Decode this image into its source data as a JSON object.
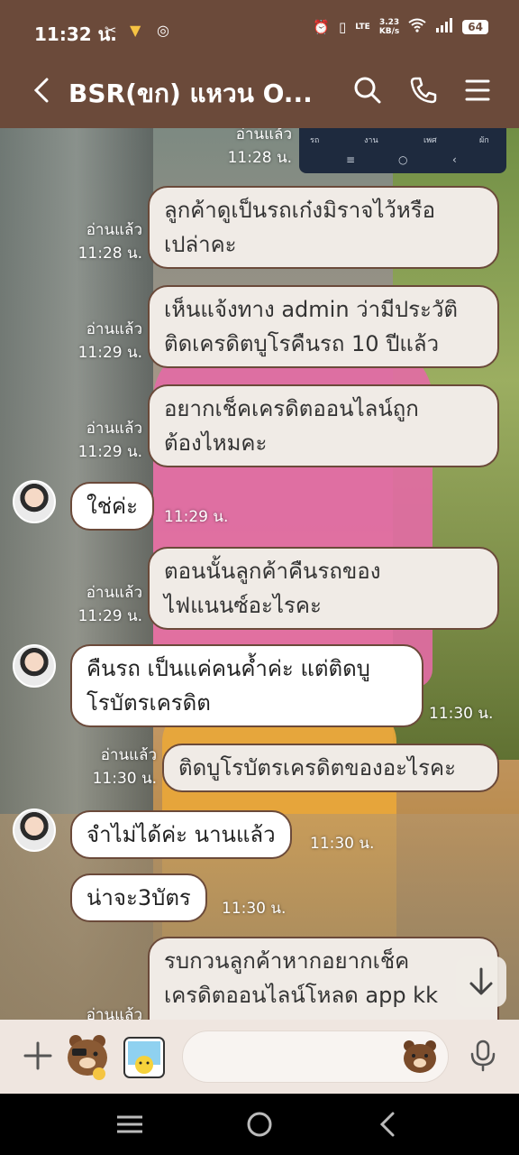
{
  "status_bar": {
    "time": "11:32 น.",
    "network_speed_value": "3.23",
    "network_speed_unit": "KB/s",
    "network_type": "LTE",
    "battery": "64"
  },
  "header": {
    "title": "BSR(ขก) แหวน O...",
    "icons": [
      "back-icon",
      "search-icon",
      "phone-icon",
      "menu-icon"
    ]
  },
  "embedded_screenshot": {
    "tabs": [
      "รถ",
      "งาน",
      "เพศ",
      "ผัก"
    ]
  },
  "messages": [
    {
      "dir": "out",
      "read": "อ่านแล้ว",
      "time": "11:28 น.",
      "lines": []
    },
    {
      "dir": "out",
      "read": "อ่านแล้ว",
      "time": "11:28 น.",
      "lines": [
        "ลูกค้าดูเป็นรถเก๋งมิราจไว้หรือ",
        "เปล่าคะ"
      ]
    },
    {
      "dir": "out",
      "read": "อ่านแล้ว",
      "time": "11:29 น.",
      "lines": [
        "เห็นแจ้งทาง admin ว่ามีประวัติ",
        "ติดเครดิตบูโรคืนรถ 10 ปีแล้ว"
      ]
    },
    {
      "dir": "out",
      "read": "อ่านแล้ว",
      "time": "11:29 น.",
      "lines": [
        "อยากเช็คเครดิตออนไลน์ถูก",
        "ต้องไหมคะ"
      ]
    },
    {
      "dir": "in",
      "time": "11:29 น.",
      "lines": [
        "ใช่ค่ะ"
      ]
    },
    {
      "dir": "out",
      "read": "อ่านแล้ว",
      "time": "11:29 น.",
      "lines": [
        "ตอนนั้นลูกค้าคืนรถของ",
        "ไฟแนนซ์อะไรคะ"
      ]
    },
    {
      "dir": "in",
      "time": "11:30 น.",
      "lines": [
        "คืนรถ เป็นแค่คนค้ำค่ะ แต่ติดบู",
        "โรบัตรเครดิต"
      ]
    },
    {
      "dir": "out",
      "read": "อ่านแล้ว",
      "time": "11:30 น.",
      "lines": [
        "ติดบูโรบัตรเครดิตของอะไรคะ"
      ]
    },
    {
      "dir": "in",
      "time": "11:30 น.",
      "lines": [
        "จำไม่ได้ค่ะ นานแล้ว"
      ]
    },
    {
      "dir": "in",
      "time": "11:30 น.",
      "lines": [
        "น่าจะ3บัตร"
      ]
    },
    {
      "dir": "out",
      "read": "อ่านแล้ว",
      "time": "",
      "lines": [
        "รบกวนลูกค้าหากอยากเช็ค",
        "เครดิตออนไลน์โหลด app kk"
      ]
    }
  ],
  "input": {
    "placeholder": ""
  }
}
